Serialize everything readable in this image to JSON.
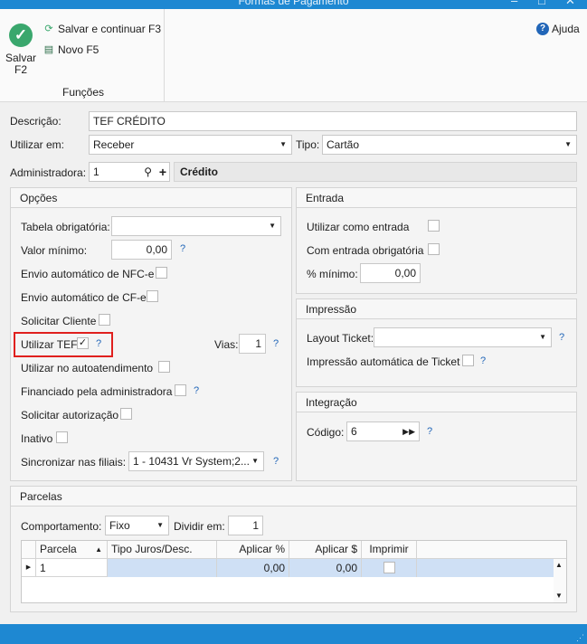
{
  "window": {
    "title": "Formas de Pagamento"
  },
  "ribbon": {
    "save_label": "Salvar",
    "save_key": "F2",
    "save_continue_label": "Salvar e continuar F3",
    "new_label": "Novo F5",
    "group_label": "Funções",
    "help_label": "Ajuda"
  },
  "form": {
    "descricao_label": "Descrição:",
    "descricao_value": "TEF CRÉDITO",
    "utilizar_label": "Utilizar em:",
    "utilizar_value": "Receber",
    "tipo_label": "Tipo:",
    "tipo_value": "Cartão",
    "admin_label": "Administradora:",
    "admin_value": "1",
    "admin_name": "Crédito"
  },
  "opcoes": {
    "title": "Opções",
    "tabela_label": "Tabela obrigatória:",
    "tabela_value": "",
    "valor_min_label": "Valor mínimo:",
    "valor_min_value": "0,00",
    "nfce_label": "Envio automático de NFC-e",
    "cfe_label": "Envio automático de CF-e",
    "solicitar_cliente_label": "Solicitar Cliente",
    "utilizar_tef_label": "Utilizar TEF",
    "utilizar_tef_checked": true,
    "vias_label": "Vias:",
    "vias_value": "1",
    "autoatendimento_label": "Utilizar no autoatendimento",
    "financiado_label": "Financiado pela administradora",
    "solicitar_autorizacao_label": "Solicitar autorização",
    "inativo_label": "Inativo",
    "sincronizar_label": "Sincronizar nas filiais:",
    "sincronizar_value": "1 - 10431 Vr System;2..."
  },
  "entrada": {
    "title": "Entrada",
    "utilizar_label": "Utilizar como entrada",
    "obrigatoria_label": "Com entrada obrigatória",
    "minimo_label": "% mínimo:",
    "minimo_value": "0,00"
  },
  "impressao": {
    "title": "Impressão",
    "layout_label": "Layout Ticket:",
    "layout_value": "",
    "automatica_label": "Impressão automática de Ticket"
  },
  "integracao": {
    "title": "Integração",
    "codigo_label": "Código:",
    "codigo_value": "6"
  },
  "parcelas": {
    "title": "Parcelas",
    "comportamento_label": "Comportamento:",
    "comportamento_value": "Fixo",
    "dividir_label": "Dividir em:",
    "dividir_value": "1",
    "columns": [
      "Parcela",
      "Tipo Juros/Desc.",
      "Aplicar %",
      "Aplicar $",
      "Imprimir"
    ],
    "rows": [
      {
        "parcela": "1",
        "tipo": "",
        "aplicar_pct": "0,00",
        "aplicar_val": "0,00",
        "imprimir": false
      }
    ]
  },
  "icons": {
    "save": "check-circle-icon",
    "save_continue": "save-continue-icon",
    "new": "new-doc-icon",
    "help": "help-icon",
    "search": "search-icon",
    "add": "plus-icon"
  },
  "colors": {
    "titlebar": "#1e88d2",
    "accent_green": "#3aa76d",
    "highlight_border": "#e0201e",
    "row_selected": "#cfe0f5"
  }
}
